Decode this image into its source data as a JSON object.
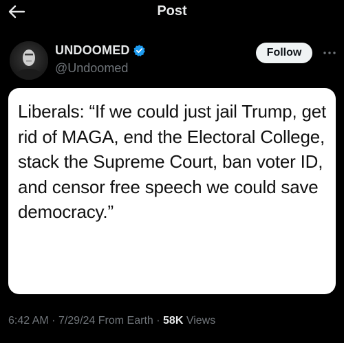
{
  "header": {
    "title": "Post",
    "back_icon": "arrow-left-icon"
  },
  "author": {
    "name": "UNDOOMED",
    "handle": "@Undoomed",
    "verified": true,
    "verified_color": "#1d9bf0"
  },
  "actions": {
    "follow_label": "Follow",
    "more_icon": "more-horizontal-icon"
  },
  "media": {
    "text": "Liberals: “If we could just jail Trump, get rid of MAGA, end the Electoral College, stack the Supreme Court, ban voter ID, and censor free speech we could save democracy.”"
  },
  "meta": {
    "time": "6:42 AM",
    "separator": "·",
    "date": "7/29/24",
    "source": "From Earth",
    "views_count": "58K",
    "views_label": "Views"
  },
  "colors": {
    "background": "#000000",
    "primary_text": "#e7e9ea",
    "secondary_text": "#71767b",
    "follow_bg": "#eff3f4"
  }
}
